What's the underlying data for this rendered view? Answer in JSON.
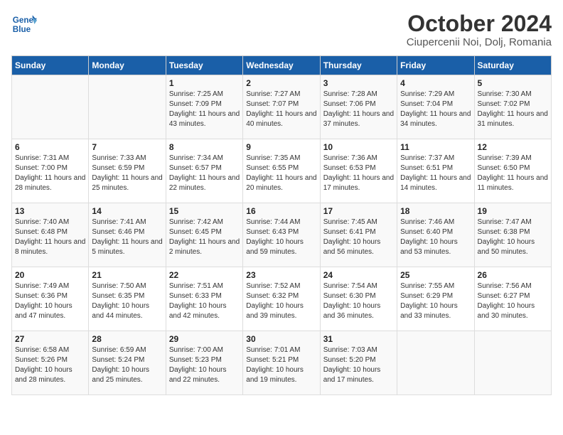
{
  "header": {
    "logo_line1": "General",
    "logo_line2": "Blue",
    "title": "October 2024",
    "subtitle": "Ciupercenii Noi, Dolj, Romania"
  },
  "weekdays": [
    "Sunday",
    "Monday",
    "Tuesday",
    "Wednesday",
    "Thursday",
    "Friday",
    "Saturday"
  ],
  "weeks": [
    [
      {
        "day": "",
        "data": ""
      },
      {
        "day": "",
        "data": ""
      },
      {
        "day": "1",
        "data": "Sunrise: 7:25 AM\nSunset: 7:09 PM\nDaylight: 11 hours and 43 minutes."
      },
      {
        "day": "2",
        "data": "Sunrise: 7:27 AM\nSunset: 7:07 PM\nDaylight: 11 hours and 40 minutes."
      },
      {
        "day": "3",
        "data": "Sunrise: 7:28 AM\nSunset: 7:06 PM\nDaylight: 11 hours and 37 minutes."
      },
      {
        "day": "4",
        "data": "Sunrise: 7:29 AM\nSunset: 7:04 PM\nDaylight: 11 hours and 34 minutes."
      },
      {
        "day": "5",
        "data": "Sunrise: 7:30 AM\nSunset: 7:02 PM\nDaylight: 11 hours and 31 minutes."
      }
    ],
    [
      {
        "day": "6",
        "data": "Sunrise: 7:31 AM\nSunset: 7:00 PM\nDaylight: 11 hours and 28 minutes."
      },
      {
        "day": "7",
        "data": "Sunrise: 7:33 AM\nSunset: 6:59 PM\nDaylight: 11 hours and 25 minutes."
      },
      {
        "day": "8",
        "data": "Sunrise: 7:34 AM\nSunset: 6:57 PM\nDaylight: 11 hours and 22 minutes."
      },
      {
        "day": "9",
        "data": "Sunrise: 7:35 AM\nSunset: 6:55 PM\nDaylight: 11 hours and 20 minutes."
      },
      {
        "day": "10",
        "data": "Sunrise: 7:36 AM\nSunset: 6:53 PM\nDaylight: 11 hours and 17 minutes."
      },
      {
        "day": "11",
        "data": "Sunrise: 7:37 AM\nSunset: 6:51 PM\nDaylight: 11 hours and 14 minutes."
      },
      {
        "day": "12",
        "data": "Sunrise: 7:39 AM\nSunset: 6:50 PM\nDaylight: 11 hours and 11 minutes."
      }
    ],
    [
      {
        "day": "13",
        "data": "Sunrise: 7:40 AM\nSunset: 6:48 PM\nDaylight: 11 hours and 8 minutes."
      },
      {
        "day": "14",
        "data": "Sunrise: 7:41 AM\nSunset: 6:46 PM\nDaylight: 11 hours and 5 minutes."
      },
      {
        "day": "15",
        "data": "Sunrise: 7:42 AM\nSunset: 6:45 PM\nDaylight: 11 hours and 2 minutes."
      },
      {
        "day": "16",
        "data": "Sunrise: 7:44 AM\nSunset: 6:43 PM\nDaylight: 10 hours and 59 minutes."
      },
      {
        "day": "17",
        "data": "Sunrise: 7:45 AM\nSunset: 6:41 PM\nDaylight: 10 hours and 56 minutes."
      },
      {
        "day": "18",
        "data": "Sunrise: 7:46 AM\nSunset: 6:40 PM\nDaylight: 10 hours and 53 minutes."
      },
      {
        "day": "19",
        "data": "Sunrise: 7:47 AM\nSunset: 6:38 PM\nDaylight: 10 hours and 50 minutes."
      }
    ],
    [
      {
        "day": "20",
        "data": "Sunrise: 7:49 AM\nSunset: 6:36 PM\nDaylight: 10 hours and 47 minutes."
      },
      {
        "day": "21",
        "data": "Sunrise: 7:50 AM\nSunset: 6:35 PM\nDaylight: 10 hours and 44 minutes."
      },
      {
        "day": "22",
        "data": "Sunrise: 7:51 AM\nSunset: 6:33 PM\nDaylight: 10 hours and 42 minutes."
      },
      {
        "day": "23",
        "data": "Sunrise: 7:52 AM\nSunset: 6:32 PM\nDaylight: 10 hours and 39 minutes."
      },
      {
        "day": "24",
        "data": "Sunrise: 7:54 AM\nSunset: 6:30 PM\nDaylight: 10 hours and 36 minutes."
      },
      {
        "day": "25",
        "data": "Sunrise: 7:55 AM\nSunset: 6:29 PM\nDaylight: 10 hours and 33 minutes."
      },
      {
        "day": "26",
        "data": "Sunrise: 7:56 AM\nSunset: 6:27 PM\nDaylight: 10 hours and 30 minutes."
      }
    ],
    [
      {
        "day": "27",
        "data": "Sunrise: 6:58 AM\nSunset: 5:26 PM\nDaylight: 10 hours and 28 minutes."
      },
      {
        "day": "28",
        "data": "Sunrise: 6:59 AM\nSunset: 5:24 PM\nDaylight: 10 hours and 25 minutes."
      },
      {
        "day": "29",
        "data": "Sunrise: 7:00 AM\nSunset: 5:23 PM\nDaylight: 10 hours and 22 minutes."
      },
      {
        "day": "30",
        "data": "Sunrise: 7:01 AM\nSunset: 5:21 PM\nDaylight: 10 hours and 19 minutes."
      },
      {
        "day": "31",
        "data": "Sunrise: 7:03 AM\nSunset: 5:20 PM\nDaylight: 10 hours and 17 minutes."
      },
      {
        "day": "",
        "data": ""
      },
      {
        "day": "",
        "data": ""
      }
    ]
  ]
}
